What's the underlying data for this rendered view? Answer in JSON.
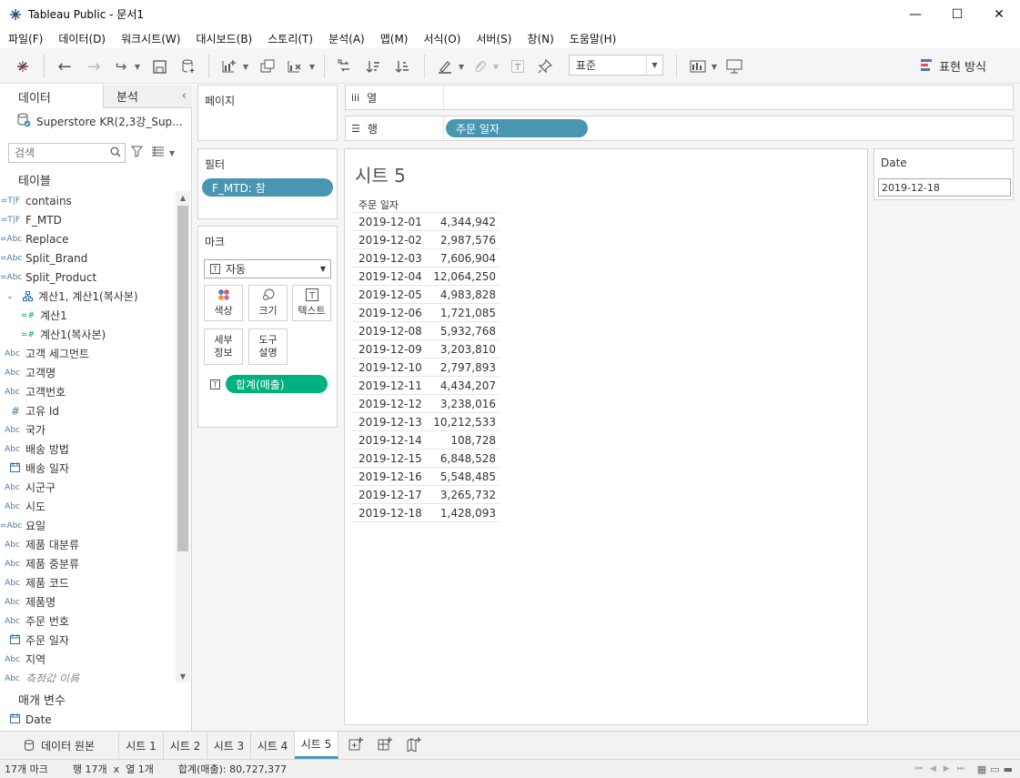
{
  "window": {
    "title": "Tableau Public - 문서1",
    "app_icon": "tableau-logo-icon"
  },
  "menu": [
    "파일(F)",
    "데이터(D)",
    "워크시트(W)",
    "대시보드(B)",
    "스토리(T)",
    "분석(A)",
    "맵(M)",
    "서식(O)",
    "서버(S)",
    "창(N)",
    "도움말(H)"
  ],
  "toolbar": {
    "fit_value": "표준",
    "show_me_label": "표현 방식"
  },
  "datapane": {
    "tab_data": "데이터",
    "tab_analytics": "분석",
    "datasource": "Superstore KR(2,3강_Sup...",
    "search_placeholder": "검색",
    "tables_header": "테이블",
    "fields": [
      {
        "icon": "=T|F",
        "label": "contains"
      },
      {
        "icon": "=T|F",
        "label": "F_MTD"
      },
      {
        "icon": "=Abc",
        "label": "Replace"
      },
      {
        "icon": "=Abc",
        "label": "Split_Brand"
      },
      {
        "icon": "=Abc",
        "label": "Split_Product"
      },
      {
        "icon": "품",
        "label": "계산1, 계산1(복사본)"
      },
      {
        "icon": "=#",
        "label": "계산1"
      },
      {
        "icon": "=#",
        "label": "계산1(복사본)"
      },
      {
        "icon": "Abc",
        "label": "고객 세그먼트"
      },
      {
        "icon": "Abc",
        "label": "고객명"
      },
      {
        "icon": "Abc",
        "label": "고객번호"
      },
      {
        "icon": "#",
        "label": "고유 Id"
      },
      {
        "icon": "Abc",
        "label": "국가"
      },
      {
        "icon": "Abc",
        "label": "배송 방법"
      },
      {
        "icon": "cal",
        "label": "배송 일자"
      },
      {
        "icon": "Abc",
        "label": "시군구"
      },
      {
        "icon": "Abc",
        "label": "시도"
      },
      {
        "icon": "=Abc",
        "label": "요일"
      },
      {
        "icon": "Abc",
        "label": "제품 대분류"
      },
      {
        "icon": "Abc",
        "label": "제품 중분류"
      },
      {
        "icon": "Abc",
        "label": "제품 코드"
      },
      {
        "icon": "Abc",
        "label": "제품명"
      },
      {
        "icon": "Abc",
        "label": "주문 번호"
      },
      {
        "icon": "cal",
        "label": "주문 일자"
      },
      {
        "icon": "Abc",
        "label": "지역"
      },
      {
        "icon": "Abc",
        "label": "측정값 이름"
      }
    ],
    "params_header": "매개 변수",
    "param_name": "Date"
  },
  "pages": {
    "title": "페이지"
  },
  "filters": {
    "title": "필터",
    "pill": "F_MTD: 참"
  },
  "marks": {
    "title": "마크",
    "type": "자동",
    "buttons": {
      "color": "색상",
      "size": "크기",
      "text": "텍스트",
      "detail": "세부\n정보",
      "tooltip": "도구\n설명"
    },
    "pill": "합계(매출)"
  },
  "columns_shelf": {
    "label": "열"
  },
  "rows_shelf": {
    "label": "행",
    "pill": "주문 일자"
  },
  "viz": {
    "title": "시트 5",
    "column_header": "주문 일자",
    "rows": [
      {
        "date": "2019-12-01",
        "value": "4,344,942"
      },
      {
        "date": "2019-12-02",
        "value": "2,987,576"
      },
      {
        "date": "2019-12-03",
        "value": "7,606,904"
      },
      {
        "date": "2019-12-04",
        "value": "12,064,250"
      },
      {
        "date": "2019-12-05",
        "value": "4,983,828"
      },
      {
        "date": "2019-12-06",
        "value": "1,721,085"
      },
      {
        "date": "2019-12-08",
        "value": "5,932,768"
      },
      {
        "date": "2019-12-09",
        "value": "3,203,810"
      },
      {
        "date": "2019-12-10",
        "value": "2,797,893"
      },
      {
        "date": "2019-12-11",
        "value": "4,434,207"
      },
      {
        "date": "2019-12-12",
        "value": "3,238,016"
      },
      {
        "date": "2019-12-13",
        "value": "10,212,533"
      },
      {
        "date": "2019-12-14",
        "value": "108,728"
      },
      {
        "date": "2019-12-15",
        "value": "6,848,528"
      },
      {
        "date": "2019-12-16",
        "value": "5,548,485"
      },
      {
        "date": "2019-12-17",
        "value": "3,265,732"
      },
      {
        "date": "2019-12-18",
        "value": "1,428,093"
      }
    ]
  },
  "param_card": {
    "title": "Date",
    "value": "2019-12-18"
  },
  "tabs": {
    "datasource": "데이터 원본",
    "sheets": [
      "시트 1",
      "시트 2",
      "시트 3",
      "시트 4",
      "시트 5"
    ],
    "active": "시트 5"
  },
  "status": {
    "marks": "17개 마크",
    "rows_cols": "행 17개  x  열 1개",
    "sum": "합계(매출): 80,727,377"
  },
  "colors": {
    "pill_blue": "#4996b2",
    "pill_green": "#00b180"
  }
}
